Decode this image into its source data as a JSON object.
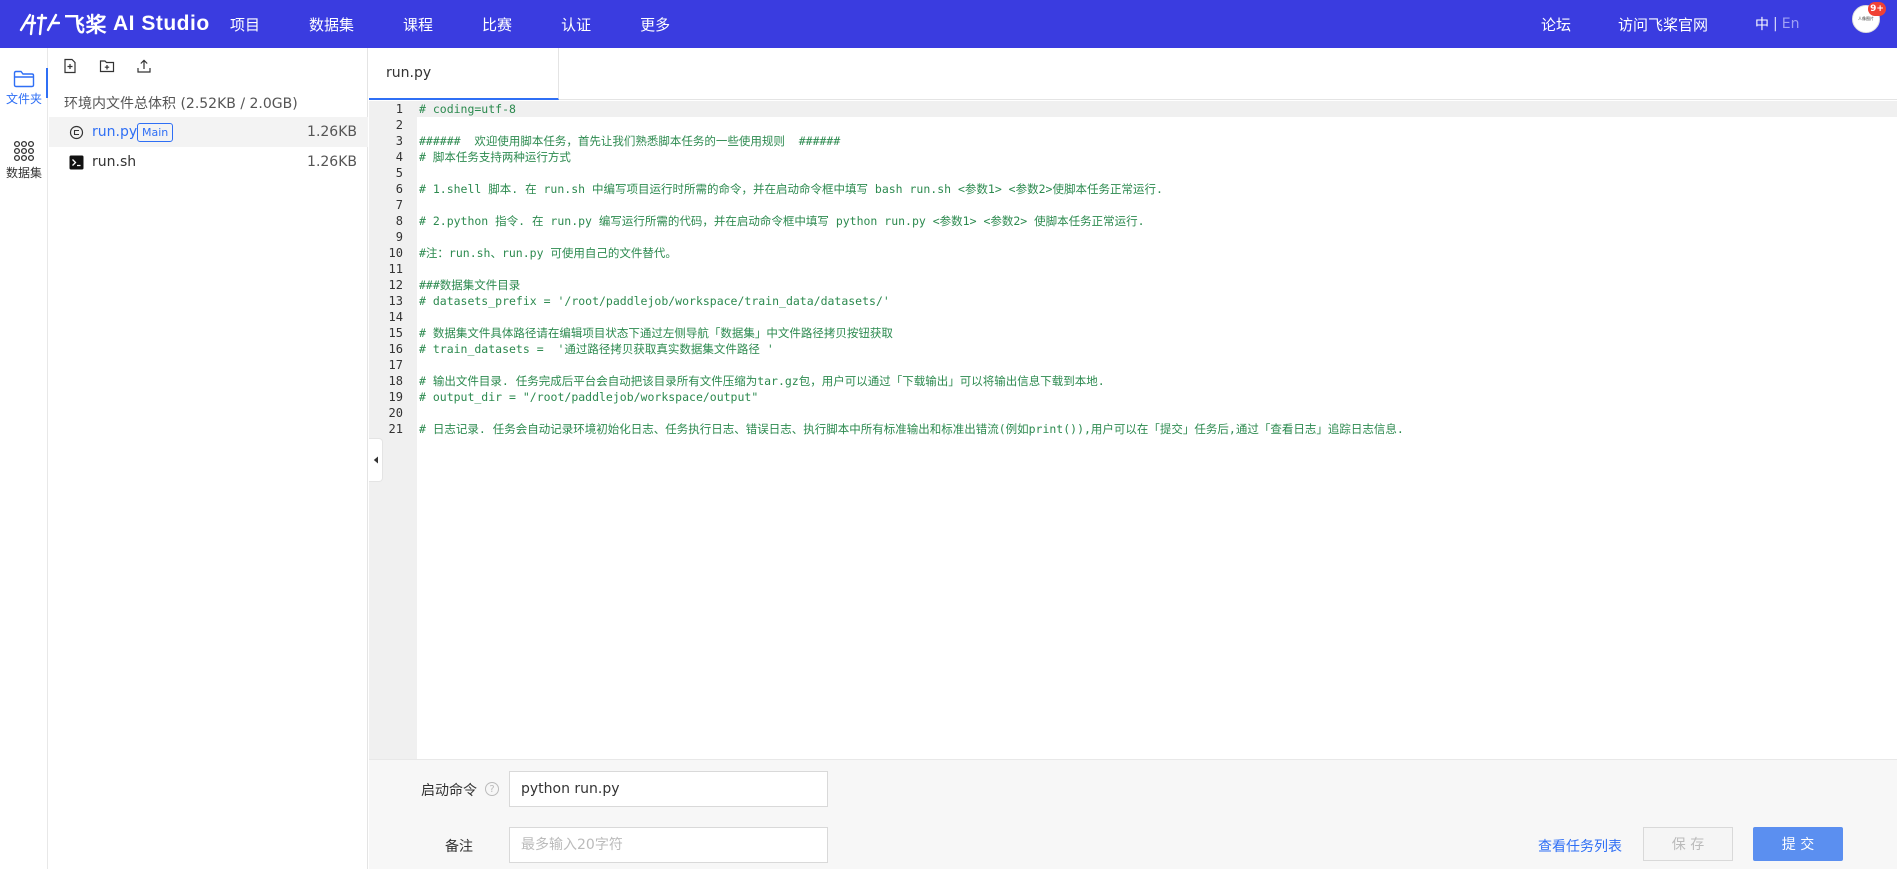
{
  "header": {
    "logo_text": "AI Studio",
    "logo_prefix": "飞桨",
    "nav": [
      "项目",
      "数据集",
      "课程",
      "比赛",
      "认证",
      "更多"
    ],
    "forum": "论坛",
    "official_site": "访问飞桨官网",
    "lang_zh": "中",
    "lang_sep": "|",
    "lang_en": "En",
    "avatar_text": "人像图片",
    "notif_badge": "9+"
  },
  "rail": {
    "folder_label": "文件夹",
    "dataset_label": "数据集"
  },
  "file_panel": {
    "total_size": "环境内文件总体积 (2.52KB / 2.0GB)",
    "files": [
      {
        "name": "run.py",
        "tag": "Main",
        "size": "1.26KB"
      },
      {
        "name": "run.sh",
        "tag": "",
        "size": "1.26KB"
      }
    ]
  },
  "editor": {
    "tab": "run.py",
    "lines": [
      "# coding=utf-8",
      "",
      "######  欢迎使用脚本任务，首先让我们熟悉脚本任务的一些使用规则  ######",
      "# 脚本任务支持两种运行方式",
      "",
      "# 1.shell 脚本. 在 run.sh 中编写项目运行时所需的命令，并在启动命令框中填写 bash run.sh <参数1> <参数2>使脚本任务正常运行.",
      "",
      "# 2.python 指令. 在 run.py 编写运行所需的代码，并在启动命令框中填写 python run.py <参数1> <参数2> 使脚本任务正常运行.",
      "",
      "#注：run.sh、run.py 可使用自己的文件替代。",
      "",
      "###数据集文件目录",
      "# datasets_prefix = '/root/paddlejob/workspace/train_data/datasets/'",
      "",
      "# 数据集文件具体路径请在编辑项目状态下通过左侧导航「数据集」中文件路径拷贝按钮获取",
      "# train_datasets =  '通过路径拷贝获取真实数据集文件路径 '",
      "",
      "# 输出文件目录. 任务完成后平台会自动把该目录所有文件压缩为tar.gz包，用户可以通过「下载输出」可以将输出信息下载到本地.",
      "# output_dir = \"/root/paddlejob/workspace/output\"",
      "",
      "# 日志记录. 任务会自动记录环境初始化日志、任务执行日志、错误日志、执行脚本中所有标准输出和标准出错流(例如print()),用户可以在「提交」任务后,通过「查看日志」追踪日志信息."
    ]
  },
  "form": {
    "cmd_label": "启动命令",
    "cmd_help": "?",
    "cmd_value": "python run.py",
    "note_label": "备注",
    "note_placeholder": "最多输入20字符",
    "view_tasks": "查看任务列表",
    "save": "保 存",
    "submit": "提 交"
  },
  "colors": {
    "header_bg": "#3a3ce0",
    "accent": "#2f6ff5",
    "code_comment": "#2c8a4f",
    "submit_bg": "#5b8ff0"
  },
  "icons": {
    "folder": "folder-icon",
    "dataset": "dataset-grid-icon",
    "new_file": "new-file-icon",
    "new_folder": "new-folder-icon",
    "upload": "upload-icon",
    "python_file": "python-file-icon",
    "shell_file": "terminal-file-icon",
    "collapse": "caret-left-icon"
  }
}
